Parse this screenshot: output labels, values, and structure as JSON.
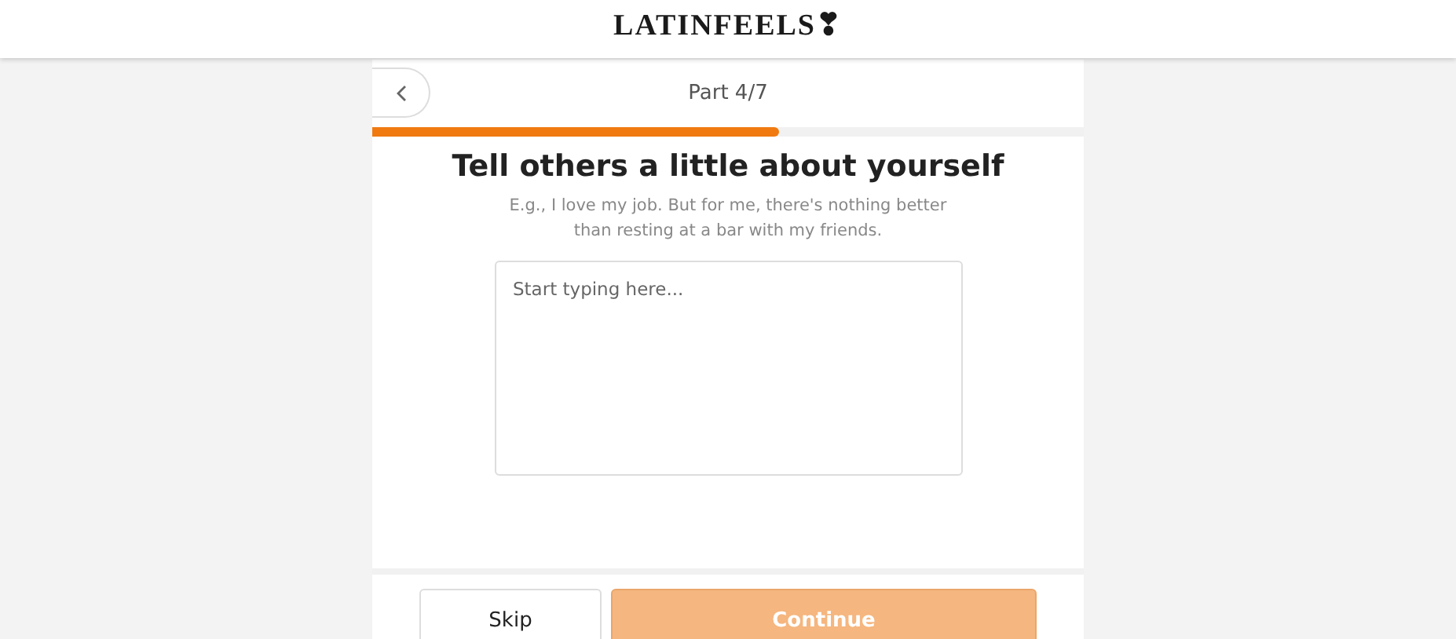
{
  "logo": "LATINFEELS❣",
  "step": {
    "label": "Part 4/7",
    "level": 0.571
  },
  "title": "Tell others a little about yourself",
  "hint": "E.g., I love my job. But for me, there's nothing better than resting at a bar with my friends.",
  "answer": {
    "placeholder": "Start typing here..."
  },
  "buttons": {
    "skip": "Skip",
    "continue": {
      "label": "Continue",
      "disabled": true
    }
  }
}
